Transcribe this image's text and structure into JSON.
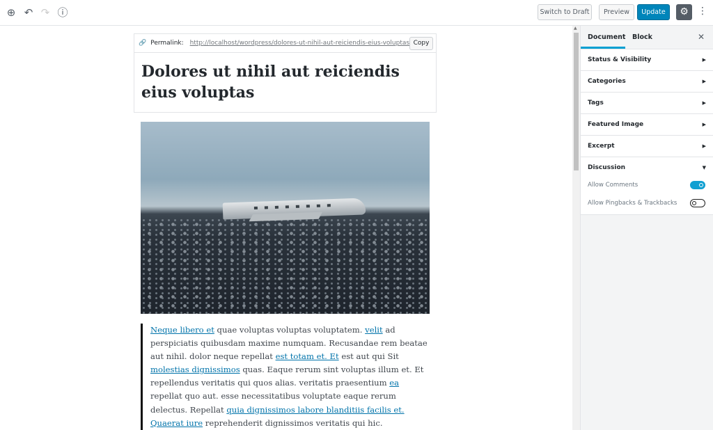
{
  "toolbar": {
    "add_icon": "plus-circle-icon",
    "undo_icon": "undo-icon",
    "redo_icon": "redo-icon",
    "info_icon": "info-icon",
    "switch_to_draft": "Switch to Draft",
    "preview": "Preview",
    "update": "Update",
    "settings_icon": "gear-icon",
    "more_icon": "kebab-icon"
  },
  "post": {
    "permalink_label": "Permalink:",
    "permalink_url": "http://localhost/wordpress/dolores-ut-nihil-aut-reiciendis-eius-voluptas/",
    "copy": "Copy",
    "title": "Dolores ut nihil aut reiciendis eius voluptas",
    "quote": [
      {
        "t": "Neque libero et",
        "link": true
      },
      {
        "t": " quae voluptas voluptas voluptatem. "
      },
      {
        "t": "velit",
        "link": true
      },
      {
        "t": " ad perspiciatis quibusdam maxime numquam. Recusandae rem beatae aut nihil. dolor neque repellat "
      },
      {
        "t": "est totam et. Et",
        "link": true
      },
      {
        "t": " est aut qui Sit "
      },
      {
        "t": "molestias dignissimos",
        "link": true
      },
      {
        "t": " quas. Eaque rerum sint voluptas illum et. Et repellendus veritatis qui quos alias. veritatis praesentium "
      },
      {
        "t": "ea",
        "link": true
      },
      {
        "t": " repellat quo aut. esse necessitatibus voluptate eaque rerum delectus. Repellat "
      },
      {
        "t": "quia dignissimos labore blanditiis facilis et. Quaerat iure",
        "link": true
      },
      {
        "t": " reprehenderit dignissimos veritatis qui hic."
      }
    ]
  },
  "sidebar": {
    "tabs": [
      "Document",
      "Block"
    ],
    "close": "✕",
    "panels": [
      "Status & Visibility",
      "Categories",
      "Tags",
      "Featured Image",
      "Excerpt"
    ],
    "discussion": {
      "title": "Discussion",
      "options": [
        {
          "label": "Allow Comments",
          "on": true
        },
        {
          "label": "Allow Pingbacks & Trackbacks",
          "on": false
        }
      ]
    }
  },
  "colors": {
    "accent": "#0085ba",
    "tab_active": "#00a0d2",
    "link": "#0073aa"
  }
}
